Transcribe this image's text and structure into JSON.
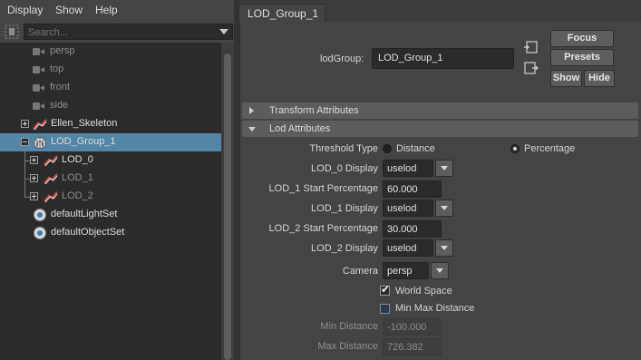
{
  "menubar": {
    "items": [
      "Display",
      "Show",
      "Help"
    ]
  },
  "outliner": {
    "search_placeholder": "Search...",
    "items": [
      {
        "label": "persp",
        "icon": "camera-icon",
        "dim": true
      },
      {
        "label": "top",
        "icon": "camera-icon",
        "dim": true
      },
      {
        "label": "front",
        "icon": "camera-icon",
        "dim": true
      },
      {
        "label": "side",
        "icon": "camera-icon",
        "dim": true
      },
      {
        "label": "Ellen_Skeleton",
        "icon": "joint-icon",
        "expander": "plus"
      },
      {
        "label": "LOD_Group_1",
        "icon": "lod-group-icon",
        "expander": "minus",
        "selected": true
      },
      {
        "label": "LOD_0",
        "icon": "joint-icon",
        "expander": "plus"
      },
      {
        "label": "LOD_1",
        "icon": "joint-icon",
        "expander": "plus",
        "dim": true
      },
      {
        "label": "LOD_2",
        "icon": "joint-icon",
        "expander": "plus",
        "dim": true
      },
      {
        "label": "defaultLightSet",
        "icon": "set-icon"
      },
      {
        "label": "defaultObjectSet",
        "icon": "set-icon"
      }
    ]
  },
  "attribute_editor": {
    "tab": "LOD_Group_1",
    "node_label": "lodGroup:",
    "node_value": "LOD_Group_1",
    "buttons": {
      "focus": "Focus",
      "presets": "Presets",
      "show": "Show",
      "hide": "Hide"
    },
    "sections": {
      "transform": "Transform Attributes",
      "lod": "Lod Attributes"
    },
    "threshold_type": {
      "label": "Threshold Type",
      "option_distance": "Distance",
      "option_percentage": "Percentage",
      "selected": "Percentage"
    },
    "lod0_display": {
      "label": "LOD_0 Display",
      "value": "uselod"
    },
    "lod1_start": {
      "label": "LOD_1 Start Percentage",
      "value": "60.000"
    },
    "lod1_display": {
      "label": "LOD_1 Display",
      "value": "uselod"
    },
    "lod2_start": {
      "label": "LOD_2 Start Percentage",
      "value": "30.000"
    },
    "lod2_display": {
      "label": "LOD_2 Display",
      "value": "uselod"
    },
    "camera": {
      "label": "Camera",
      "value": "persp"
    },
    "world_space": {
      "label": "World Space",
      "checked": true
    },
    "min_max_distance": {
      "label": "Min Max Distance",
      "checked": false
    },
    "min_distance": {
      "label": "Min Distance",
      "value": "-100.000"
    },
    "max_distance": {
      "label": "Max Distance",
      "value": "726.382"
    }
  },
  "colors": {
    "selection": "#5285a6",
    "panel": "#444444",
    "field": "#2b2b2b",
    "button": "#5d5d5d"
  }
}
